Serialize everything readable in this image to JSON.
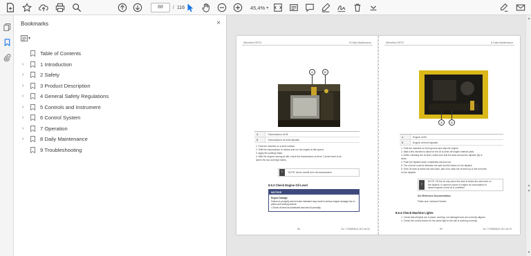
{
  "toolbar": {
    "current_page": "88",
    "page_separator": "/",
    "total_pages": "116",
    "zoom": "45,4%"
  },
  "panel": {
    "title": "Bookmarks",
    "close": "×"
  },
  "bookmarks": [
    {
      "label": "Table of Contents",
      "expandable": false
    },
    {
      "label": "1 Introduction",
      "expandable": true
    },
    {
      "label": "2 Safety",
      "expandable": true
    },
    {
      "label": "3 Product Description",
      "expandable": true
    },
    {
      "label": "4 General Safety Regulations",
      "expandable": true
    },
    {
      "label": "5 Controls and Instrument",
      "expandable": true
    },
    {
      "label": "6 Control System",
      "expandable": true
    },
    {
      "label": "7 Operation",
      "expandable": true
    },
    {
      "label": "8 Daily Maintenance",
      "expandable": true
    },
    {
      "label": "9 Troubleshooting",
      "expandable": false
    }
  ],
  "page_left": {
    "header_left": "Wheelbed SRTG",
    "header_right": "8 Daily Maintenance",
    "callout_a": "A",
    "callout_b": "B",
    "legend": [
      {
        "key": "A",
        "value": "Transmission oil fill"
      },
      {
        "key": "B",
        "value": "Transmission oil level dipstick"
      }
    ],
    "steps": [
      "1.  Park the machine on a level surface.",
      "2.  Shift the transmission to neutral and run the engine at idle speed.",
      "3.  Apply the parking brake.",
      "4.  With the engine running at idle, check the transmission oil level. Correct level is be-",
      "     tween the low and high marks."
    ],
    "note": "NOTE: Never overfill oil in the transmission.",
    "section": "8.5.3 Check Engine Oil Level",
    "notice_title": "NOTICE",
    "notice_lines": [
      "Engine Damage",
      "Failure to promptly add oil when indicated may result in serious engine damage due to",
      "piston and seizing seizure.",
      "•  Check oil level as scheduled and add oil promptly."
    ],
    "footer_left": "88",
    "footer_right": "No. TY526B3611-001 ver.03"
  },
  "page_right": {
    "header_left": "Wheelbed SRTG",
    "header_right": "8 Daily Maintenance",
    "callout_a": "A",
    "callout_b": "B",
    "legend": [
      {
        "key": "A",
        "value": "Engine oil fill"
      },
      {
        "key": "B",
        "value": "Engine oil level dipstick"
      }
    ],
    "steps": [
      "1.  Park the machine on level ground and stop the engine.",
      "2.  Wait a few minutes to allow for the oil to drain off engine internal parts.",
      "3.  When checking the oil level, make sure that the area around the dipstick (B) is",
      "     clean.",
      "4.  Push the dipstick down completely and pull out.",
      "5.  The oil level must be between the add and full marks on the dipstick.",
      "6.  If the oil level is below the add mark, add oil to raise the oil level up to the full mark",
      "     on the dipstick."
    ],
    "note_lines": [
      "NOTE: Fill the oil only when the level is below the add mark on",
      "the dipstick. A common cause of engine oil consumption in",
      "diesel engines is that oil is overfilled."
    ],
    "see_ref": "See Reference Documentation",
    "see_ref_item": "Fluids and Lubricant Grades",
    "section": "8.5.4 Check Machine Lights",
    "steps2": [
      "1.  Check that all lights are in place, working, not damaged and are correctly aligned.",
      "2.  Check the control button for the dome light in the cab is working correctly."
    ],
    "footer_left": "89",
    "footer_right": "No. TY526B3611-001 ver.03"
  }
}
